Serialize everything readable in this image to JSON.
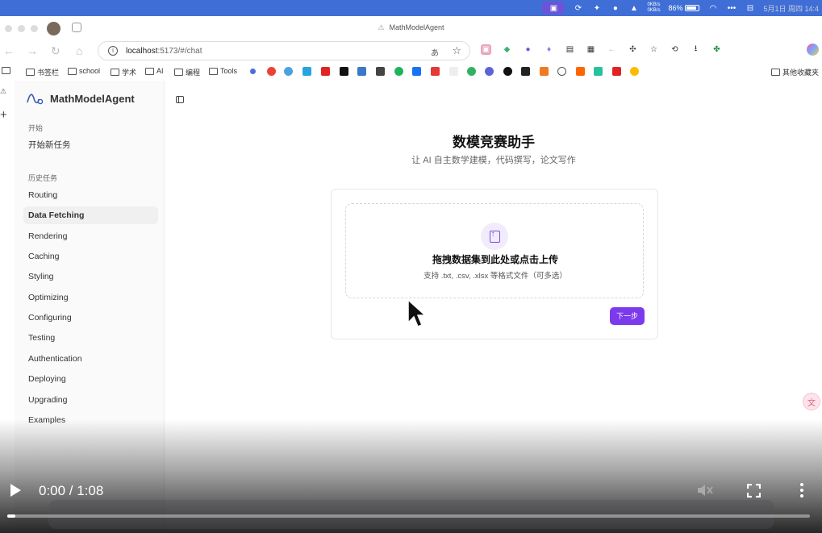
{
  "menubar": {
    "net_up": "0KB/s",
    "net_down": "0KB/s",
    "battery": "86%",
    "clock": "5月1日 周四 14:4"
  },
  "browser": {
    "tab_title": "MathModelAgent",
    "url_host": "localhost",
    "url_path": ":5173/#/chat",
    "translate_icon": "あ",
    "bookmarks": [
      "书签栏",
      "school",
      "学术",
      "AI",
      "编程",
      "Tools"
    ],
    "bookmarks_right": "其他收藏夹"
  },
  "sidebar": {
    "app_name": "MathModelAgent",
    "start_label": "开始",
    "new_task": "开始新任务",
    "history_label": "历史任务",
    "items": [
      "Routing",
      "Data Fetching",
      "Rendering",
      "Caching",
      "Styling",
      "Optimizing",
      "Configuring",
      "Testing",
      "Authentication",
      "Deploying",
      "Upgrading",
      "Examples"
    ],
    "active_item": "Data Fetching"
  },
  "main": {
    "title": "数模竞赛助手",
    "subtitle": "让 AI 自主数学建模，代码撰写，论文写作",
    "upload_title": "拖拽数据集到此处或点击上传",
    "upload_hint": "支持 .txt, .csv, .xlsx 等格式文件（可多选）",
    "next_button": "下一步"
  },
  "video": {
    "time": "0:00 / 1:08",
    "progress": 0.01
  }
}
